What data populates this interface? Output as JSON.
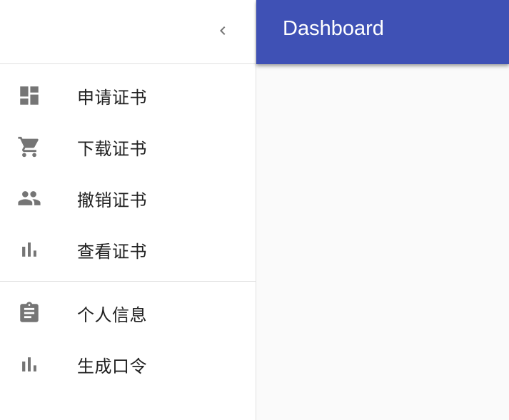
{
  "appbar": {
    "title": "Dashboard",
    "color": "#3f51b5"
  },
  "drawer": {
    "collapse_icon": "chevron-left-icon",
    "primary_items": [
      {
        "label": "申请证书",
        "icon": "dashboard-icon"
      },
      {
        "label": "下载证书",
        "icon": "shopping-cart-icon"
      },
      {
        "label": "撤销证书",
        "icon": "people-icon"
      },
      {
        "label": "查看证书",
        "icon": "bar-chart-icon"
      }
    ],
    "secondary_items": [
      {
        "label": "个人信息",
        "icon": "assignment-icon"
      },
      {
        "label": "生成口令",
        "icon": "bar-chart-icon"
      }
    ]
  }
}
